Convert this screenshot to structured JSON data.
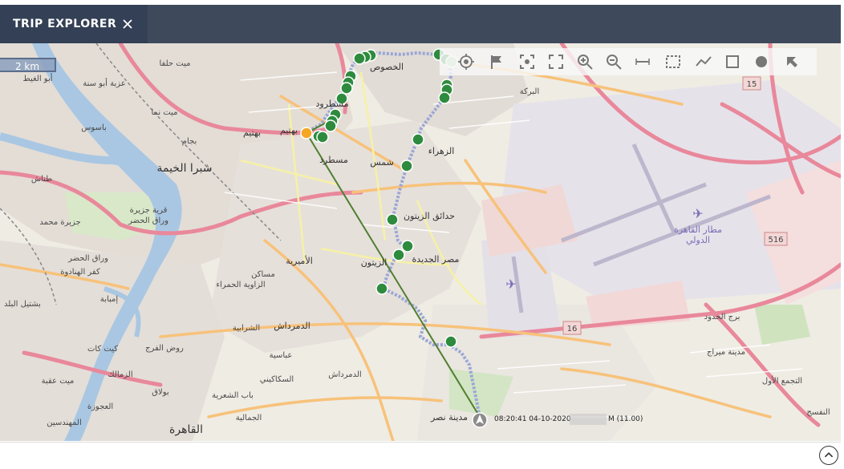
{
  "window": {
    "title": "TRIP EXPLORER",
    "close_icon": "close-icon",
    "header_color": "#3e4a5c",
    "tab_color": "#334055"
  },
  "map": {
    "scale_label": "2 km",
    "route_color": "#9aa6d6",
    "stop_color": "#2e8b3e",
    "start_color": "#f5a623",
    "line_color": "#4f7f2f",
    "labels": [
      "ميت حلفا",
      "عزبة أبو سنة",
      "أبو الغيط",
      "ميت نما",
      "باسوس",
      "بجام",
      "شبرا الخيمة",
      "طناش",
      "قرية جزيرة وراق الحضر",
      "جزيرة محمد",
      "وراق الحضر",
      "كفر الهنادوة",
      "إمبابة",
      "بشتيل البلد",
      "ميت عقبة",
      "الزمالك",
      "روض الفرج",
      "كيت كات",
      "العجوزة",
      "بولاق",
      "المهندسين",
      "القاهرة",
      "الجمالية",
      "باب الشعرية",
      "السكاكيني",
      "عباسية",
      "الشرابية",
      "الدمرداش",
      "الأميرية",
      "مساكن الزاوية الحمراء",
      "مسطرد",
      "بهتيم",
      "الخصوص",
      "البركة",
      "الزهراء",
      "شمس",
      "حدائق الزيتون",
      "مصر الجديدة",
      "الزيتون",
      "مطار القاهرة الدولي",
      "برج الحدود",
      "مدينة ميراج",
      "التجمع الأول",
      "مدينة نصر",
      "النفسج",
      "15",
      "516",
      "16"
    ],
    "timestamp": "08:20:41 04-10-2020",
    "timestamp_suffix": "M (11.00)"
  },
  "toolbar": {
    "tools": [
      "target-icon",
      "flag-icon",
      "focus-icon",
      "fullscreen-icon",
      "zoom-in-icon",
      "zoom-out-icon",
      "ruler-icon",
      "select-area-icon",
      "line-chart-icon",
      "square-icon",
      "circle-icon",
      "pointer-icon"
    ]
  },
  "footer": {
    "collapse_icon": "chevron-up-icon"
  }
}
